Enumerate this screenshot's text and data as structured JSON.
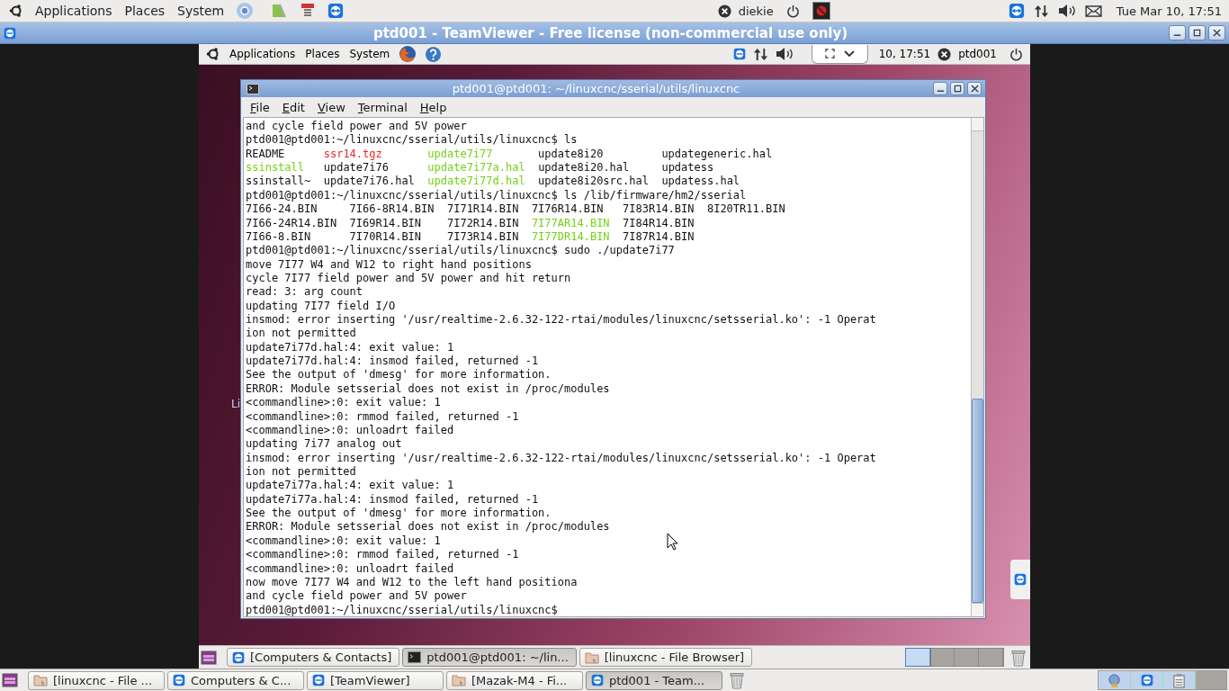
{
  "top_panel": {
    "menus": [
      "Applications",
      "Places",
      "System"
    ],
    "user": "diekie",
    "clock": "Tue Mar 10, 17:51"
  },
  "window": {
    "title": "ptd001 - TeamViewer - Free license (non-commercial use only)"
  },
  "remote": {
    "top_panel": {
      "menus": [
        "Applications",
        "Places",
        "System"
      ],
      "clock": "10, 17:51",
      "user": "ptd001"
    },
    "desktop_label": "Li",
    "terminal": {
      "title": "ptd001@ptd001: ~/linuxcnc/sserial/utils/linuxcnc",
      "menus": [
        "File",
        "Edit",
        "View",
        "Terminal",
        "Help"
      ],
      "lines": [
        {
          "parts": [
            {
              "text": "and cycle field power and 5V power"
            }
          ]
        },
        {
          "parts": [
            {
              "text": "ptd001@ptd001:~/linuxcnc/sserial/utils/linuxcnc$ ls"
            }
          ]
        },
        {
          "parts": [
            {
              "text": "README      "
            },
            {
              "text": "ssr14.tgz       ",
              "color": "#ef2929"
            },
            {
              "text": "update7i77",
              "color": "#73d216"
            },
            {
              "text": "       update8i20         updategeneric.hal"
            }
          ]
        },
        {
          "parts": [
            {
              "text": "ssinstall",
              "color": "#73d216"
            },
            {
              "text": "   update7i76      "
            },
            {
              "text": "update7i77a.hal",
              "color": "#73d216"
            },
            {
              "text": "  update8i20.hal     updatess"
            }
          ]
        },
        {
          "parts": [
            {
              "text": "ssinstall~  update7i76.hal  "
            },
            {
              "text": "update7i77d.hal",
              "color": "#73d216"
            },
            {
              "text": "  update8i20src.hal  updatess.hal"
            }
          ]
        },
        {
          "parts": [
            {
              "text": "ptd001@ptd001:~/linuxcnc/sserial/utils/linuxcnc$ ls /lib/firmware/hm2/sserial"
            }
          ]
        },
        {
          "parts": [
            {
              "text": "7I66-24.BIN     7I66-8R14.BIN  7I71R14.BIN  7I76R14.BIN   7I83R14.BIN  8I20TR11.BIN"
            }
          ]
        },
        {
          "parts": [
            {
              "text": "7I66-24R14.BIN  7I69R14.BIN    7I72R14.BIN  "
            },
            {
              "text": "7I77AR14.BIN",
              "color": "#73d216"
            },
            {
              "text": "  7I84R14.BIN"
            }
          ]
        },
        {
          "parts": [
            {
              "text": "7I66-8.BIN      7I70R14.BIN    7I73R14.BIN  "
            },
            {
              "text": "7I77DR14.BIN",
              "color": "#73d216"
            },
            {
              "text": "  7I87R14.BIN"
            }
          ]
        },
        {
          "parts": [
            {
              "text": "ptd001@ptd001:~/linuxcnc/sserial/utils/linuxcnc$ sudo ./update7i77"
            }
          ]
        },
        {
          "parts": [
            {
              "text": "move 7I77 W4 and W12 to right hand positions"
            }
          ]
        },
        {
          "parts": [
            {
              "text": "cycle 7I77 field power and 5V power and hit return"
            }
          ]
        },
        {
          "parts": [
            {
              "text": "read: 3: arg count"
            }
          ]
        },
        {
          "parts": [
            {
              "text": "updating 7I77 field I/O"
            }
          ]
        },
        {
          "parts": [
            {
              "text": "insmod: error inserting '/usr/realtime-2.6.32-122-rtai/modules/linuxcnc/setsserial.ko': -1 Operat"
            }
          ]
        },
        {
          "parts": [
            {
              "text": "ion not permitted"
            }
          ]
        },
        {
          "parts": [
            {
              "text": "update7i77d.hal:4: exit value: 1"
            }
          ]
        },
        {
          "parts": [
            {
              "text": "update7i77d.hal:4: insmod failed, returned -1"
            }
          ]
        },
        {
          "parts": [
            {
              "text": "See the output of 'dmesg' for more information."
            }
          ]
        },
        {
          "parts": [
            {
              "text": "ERROR: Module setsserial does not exist in /proc/modules"
            }
          ]
        },
        {
          "parts": [
            {
              "text": "<commandline>:0: exit value: 1"
            }
          ]
        },
        {
          "parts": [
            {
              "text": "<commandline>:0: rmmod failed, returned -1"
            }
          ]
        },
        {
          "parts": [
            {
              "text": "<commandline>:0: unloadrt failed"
            }
          ]
        },
        {
          "parts": [
            {
              "text": "updating 7i77 analog out"
            }
          ]
        },
        {
          "parts": [
            {
              "text": "insmod: error inserting '/usr/realtime-2.6.32-122-rtai/modules/linuxcnc/setsserial.ko': -1 Operat"
            }
          ]
        },
        {
          "parts": [
            {
              "text": "ion not permitted"
            }
          ]
        },
        {
          "parts": [
            {
              "text": "update7i77a.hal:4: exit value: 1"
            }
          ]
        },
        {
          "parts": [
            {
              "text": "update7i77a.hal:4: insmod failed, returned -1"
            }
          ]
        },
        {
          "parts": [
            {
              "text": "See the output of 'dmesg' for more information."
            }
          ]
        },
        {
          "parts": [
            {
              "text": "ERROR: Module setsserial does not exist in /proc/modules"
            }
          ]
        },
        {
          "parts": [
            {
              "text": "<commandline>:0: exit value: 1"
            }
          ]
        },
        {
          "parts": [
            {
              "text": "<commandline>:0: rmmod failed, returned -1"
            }
          ]
        },
        {
          "parts": [
            {
              "text": "<commandline>:0: unloadrt failed"
            }
          ]
        },
        {
          "parts": [
            {
              "text": "now move 7I77 W4 and W12 to the left hand positiona"
            }
          ]
        },
        {
          "parts": [
            {
              "text": "and cycle field power and 5V power"
            }
          ]
        },
        {
          "parts": [
            {
              "text": "ptd001@ptd001:~/linuxcnc/sserial/utils/linuxcnc$"
            }
          ]
        }
      ]
    },
    "taskbar": {
      "tasks": [
        {
          "label": "[Computers & Contacts]",
          "kind": "teamviewer",
          "selected": false
        },
        {
          "label": "ptd001@ptd001: ~/lin...",
          "kind": "terminal",
          "selected": true
        },
        {
          "label": "[linuxcnc - File Browser]",
          "kind": "folder",
          "selected": false
        }
      ],
      "workspaces": [
        {
          "selected": true
        },
        {
          "selected": false
        },
        {
          "selected": false
        },
        {
          "selected": false
        }
      ]
    }
  },
  "taskbar": {
    "tasks": [
      {
        "label": "[linuxcnc - File ...",
        "kind": "folder",
        "selected": false
      },
      {
        "label": "Computers & C...",
        "kind": "teamviewer",
        "selected": false
      },
      {
        "label": "[TeamViewer]",
        "kind": "teamviewer",
        "selected": false
      },
      {
        "label": "[Mazak-M4 - Fi...",
        "kind": "folder",
        "selected": false
      },
      {
        "label": "ptd001 - Team...",
        "kind": "teamviewer",
        "selected": true
      }
    ]
  }
}
